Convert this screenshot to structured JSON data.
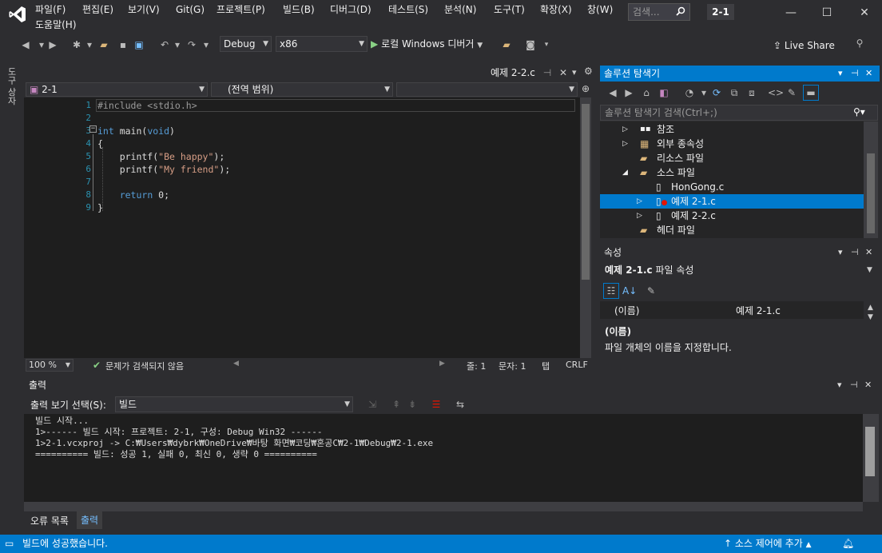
{
  "titlebar": {
    "menus": [
      "파일(F)",
      "편집(E)",
      "보기(V)",
      "Git(G)",
      "프로젝트(P)",
      "빌드(B)",
      "디버그(D)",
      "테스트(S)",
      "분석(N)",
      "도구(T)",
      "확장(X)",
      "창(W)"
    ],
    "help_menu": "도움말(H)",
    "search_placeholder": "검색...",
    "solution_name": "2-1"
  },
  "toolbar": {
    "config": "Debug",
    "platform": "x86",
    "run_label": "로컬 Windows 디버거",
    "live_share": "Live Share"
  },
  "left_strip": {
    "toolbox_label": "도구 상자"
  },
  "editor": {
    "tab_label": "예제 2-2.c",
    "nav_project": "2-1",
    "nav_scope": "(전역 범위)",
    "nav_member": "",
    "line_numbers": [
      "1",
      "2",
      "3",
      "4",
      "5",
      "6",
      "7",
      "8",
      "9"
    ],
    "lines": [
      "#include <stdio.h>",
      "",
      "int main(void)",
      "{",
      "    printf(\"Be happy\");",
      "    printf(\"My friend\");",
      "",
      "    return 0;",
      "}"
    ],
    "zoom": "100 %",
    "issues": "문제가 검색되지 않음",
    "line_col": "줄: 1",
    "char_col": "문자: 1",
    "tab_mode": "탭",
    "eol": "CRLF"
  },
  "solution_explorer": {
    "title": "솔루션 탐색기",
    "search_placeholder": "솔루션 탐색기 검색(Ctrl+;)",
    "items": [
      {
        "label": "참조",
        "icon": "references-icon"
      },
      {
        "label": "외부 종속성",
        "icon": "external-deps-icon"
      },
      {
        "label": "리소스 파일",
        "icon": "folder-icon"
      },
      {
        "label": "소스 파일",
        "icon": "folder-open-icon"
      },
      {
        "label": "HonGong.c",
        "icon": "c-file-icon"
      },
      {
        "label": "예제 2-1.c",
        "icon": "c-file-error-icon"
      },
      {
        "label": "예제 2-2.c",
        "icon": "c-file-icon"
      },
      {
        "label": "헤더 파일",
        "icon": "folder-icon"
      }
    ]
  },
  "properties": {
    "title": "속성",
    "object_name": "예제 2-1.c",
    "object_type": "파일 속성",
    "prop_name": "(이름)",
    "prop_value": "예제 2-1.c",
    "desc_title": "(이름)",
    "desc_text": "파일 개체의 이름을 지정합니다."
  },
  "output": {
    "title": "출력",
    "source_label": "출력 보기 선택(S):",
    "source_value": "빌드",
    "lines": [
      "빌드 시작...",
      "1>------ 빌드 시작: 프로젝트: 2-1, 구성: Debug Win32 ------",
      "1>2-1.vcxproj -> C:₩Users₩dybrk₩OneDrive₩바탕 화면₩코딩₩혼공C₩2-1₩Debug₩2-1.exe",
      "========== 빌드: 성공 1, 실패 0, 최신 0, 생략 0 =========="
    ],
    "tabs": [
      "오류 목록",
      "출력"
    ]
  },
  "statusbar": {
    "message": "빌드에 성공했습니다.",
    "source_control": "소스 제어에 추가"
  },
  "colors": {
    "accent": "#007acc",
    "keyword": "#569cd6",
    "string": "#d69d85",
    "preproc": "#9b9b9b",
    "line_number": "#2b91af"
  }
}
